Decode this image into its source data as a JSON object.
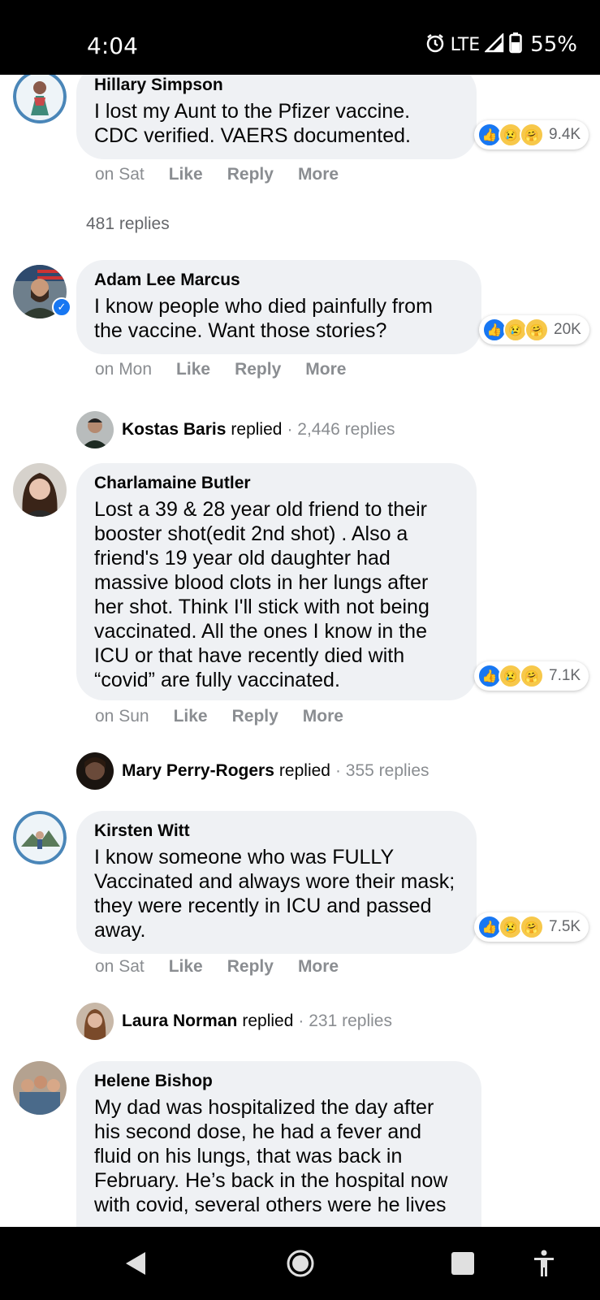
{
  "status_bar": {
    "time": "4:04",
    "network": "LTE",
    "battery": "55%"
  },
  "comments": [
    {
      "author": "Hillary Simpson",
      "text": "I lost my Aunt to the Pfizer vaccine. CDC verified. VAERS documented.",
      "reaction_count": "9.4K",
      "timestamp": "on Sat",
      "like": "Like",
      "reply": "Reply",
      "more": "More",
      "replies_summary": "481 replies"
    },
    {
      "author": "Adam Lee Marcus",
      "text": "I know people who died painfully from the vaccine. Want those stories?",
      "reaction_count": "20K",
      "timestamp": "on Mon",
      "like": "Like",
      "reply": "Reply",
      "more": "More",
      "replier": "Kostas Baris",
      "replied_word": "replied",
      "replies_summary": "· 2,446 replies"
    },
    {
      "author": "Charlamaine Butler",
      "text": "Lost a 39 & 28 year old friend to their booster shot(edit 2nd shot) . Also a friend's 19 year old daughter had massive blood clots in her lungs after her shot. Think I'll stick with not being vaccinated. All the ones I know in the ICU or that have recently died with “covid” are fully vaccinated.",
      "reaction_count": "7.1K",
      "timestamp": "on Sun",
      "like": "Like",
      "reply": "Reply",
      "more": "More",
      "replier": "Mary Perry-Rogers",
      "replied_word": "replied",
      "replies_summary": "· 355 replies"
    },
    {
      "author": "Kirsten Witt",
      "text": "I know someone who was FULLY Vaccinated and always wore their mask; they were recently in ICU and passed away.",
      "reaction_count": "7.5K",
      "timestamp": "on Sat",
      "like": "Like",
      "reply": "Reply",
      "more": "More",
      "replier": "Laura Norman",
      "replied_word": "replied",
      "replies_summary": "· 231 replies"
    },
    {
      "author": "Helene Bishop",
      "text": "My dad was hospitalized the day after his second dose, he had a fever and fluid on his lungs, that was back in February. He’s back in the hospital now with covid, several others were he lives"
    }
  ],
  "nav_bar": {
    "back": "back-icon",
    "home": "home-icon",
    "recents": "recents-icon",
    "accessibility": "accessibility-icon"
  },
  "colors": {
    "bubble": "#eff1f4",
    "like_blue": "#1877f2",
    "meta_gray": "#8a8d91"
  }
}
